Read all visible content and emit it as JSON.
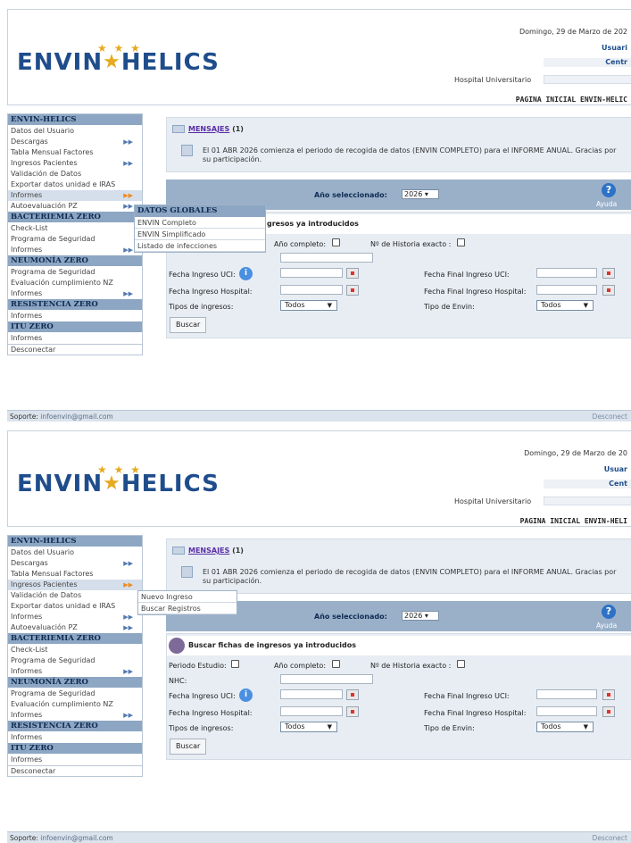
{
  "screens": [
    {
      "header": {
        "logo": {
          "left": "ENVIN",
          "right": "HELICS"
        },
        "date": "Domingo, 29 de Marzo de 202",
        "user_label": "Usuari",
        "center_label": "Centr",
        "hospital": "Hospital Universitario",
        "page_title": "PAGINA INICIAL ENVIN-HELIC"
      },
      "sidebar": {
        "sections": [
          {
            "title": "ENVIN-HELICS",
            "items": [
              "Datos del Usuario",
              "Descargas",
              "Tabla Mensual Factores",
              "Ingresos Pacientes",
              "Validación de Datos",
              "Exportar datos unidad e IRAS",
              "Informes",
              "Autoevaluación PZ"
            ]
          },
          {
            "title": "BACTERIEMIA ZERO",
            "items": [
              "Check-List",
              "Programa de Seguridad",
              "Informes"
            ]
          },
          {
            "title": "NEUMONÍA ZERO",
            "items": [
              "Programa de Seguridad",
              "Evaluación cumplimiento NZ",
              "Informes"
            ]
          },
          {
            "title": "RESISTENCIA ZERO",
            "items": [
              "Informes"
            ]
          },
          {
            "title": "ITU ZERO",
            "items": [
              "Informes"
            ]
          }
        ],
        "logout": "Desconectar"
      },
      "flyout": {
        "header": "DATOS GLOBALES",
        "items": [
          "ENVIN Completo",
          "ENVIN Simplificado",
          "Listado de infecciones"
        ]
      },
      "messages": {
        "title_link": "MENSAJES",
        "count": "(1)",
        "text": "El 01 ABR 2026 comienza el periodo de recogida de datos (ENVIN COMPLETO) para el INFORME ANUAL. Gracias por su participación."
      },
      "yearbar": {
        "label": "Año seleccionado:",
        "year": "2026",
        "help": "Ayuda"
      },
      "search": {
        "heading": "gresos ya introducidos",
        "year_complete": "Año completo:",
        "history_exact": "Nº de Historia exacto :",
        "icu_date": "Fecha Ingreso UCI:",
        "icu_end": "Fecha Final Ingreso UCI:",
        "hosp_date": "Fecha Ingreso Hospital:",
        "hosp_end": "Fecha Final Ingreso Hospital:",
        "types": "Tipos de ingresos:",
        "types_value": "Todos",
        "envin_type": "Tipo de Envin:",
        "envin_value": "Todos",
        "button": "Buscar"
      },
      "footer": {
        "support_label": "Soporte:",
        "email": "infoenvin@gmail.com",
        "logout": "Desconect"
      }
    },
    {
      "header": {
        "logo": {
          "left": "ENVIN",
          "right": "HELICS"
        },
        "date": "Domingo, 29 de Marzo de 20",
        "user_label": "Usuar",
        "center_label": "Cent",
        "hospital": "Hospital Universitario",
        "page_title": "PAGINA INICIAL ENVIN-HELI"
      },
      "sidebar": {
        "sections": [
          {
            "title": "ENVIN-HELICS",
            "items": [
              "Datos del Usuario",
              "Descargas",
              "Tabla Mensual Factores",
              "Ingresos Pacientes",
              "Validación de Datos",
              "Exportar datos unidad e IRAS",
              "Informes",
              "Autoevaluación PZ"
            ]
          },
          {
            "title": "BACTERIEMIA ZERO",
            "items": [
              "Check-List",
              "Programa de Seguridad",
              "Informes"
            ]
          },
          {
            "title": "NEUMONÍA ZERO",
            "items": [
              "Programa de Seguridad",
              "Evaluación cumplimiento NZ",
              "Informes"
            ]
          },
          {
            "title": "RESISTENCIA ZERO",
            "items": [
              "Informes"
            ]
          },
          {
            "title": "ITU ZERO",
            "items": [
              "Informes"
            ]
          }
        ],
        "logout": "Desconectar"
      },
      "flyout": {
        "items": [
          "Nuevo Ingreso",
          "Buscar Registros"
        ]
      },
      "messages": {
        "title_link": "MENSAJES",
        "count": "(1)",
        "text": "El 01 ABR 2026 comienza el periodo de recogida de datos (ENVIN COMPLETO) para el INFORME ANUAL. Gracias por su participación."
      },
      "yearbar": {
        "label": "Año seleccionado:",
        "year": "2026",
        "help": "Ayuda"
      },
      "search": {
        "heading": "Buscar fichas de ingresos ya introducidos",
        "period": "Periodo Estudio:",
        "year_complete": "Año completo:",
        "history_exact": "Nº de Historia exacto :",
        "nhc": "NHC:",
        "icu_date": "Fecha Ingreso UCI:",
        "icu_end": "Fecha Final Ingreso UCI:",
        "hosp_date": "Fecha Ingreso Hospital:",
        "hosp_end": "Fecha Final Ingreso Hospital:",
        "types": "Tipos de ingresos:",
        "types_value": "Todos",
        "envin_type": "Tipo de Envin:",
        "envin_value": "Todos",
        "button": "Buscar"
      },
      "footer": {
        "support_label": "Soporte:",
        "email": "infoenvin@gmail.com",
        "logout": "Desconect"
      }
    }
  ]
}
